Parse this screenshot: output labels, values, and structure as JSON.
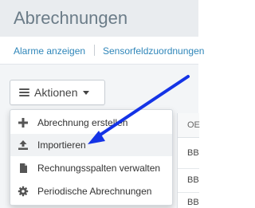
{
  "header": {
    "title": "Abrechnungen"
  },
  "subnav": {
    "alarms_link": "Alarme anzeigen",
    "sensor_link": "Sensorfeldzuordnungen"
  },
  "actions": {
    "label": "Aktionen",
    "icon": "hamburger-icon",
    "caret": "caret-down-icon"
  },
  "menu": {
    "items": [
      {
        "label": "Abrechnung erstellen",
        "icon": "plus-icon"
      },
      {
        "label": "Importieren",
        "icon": "upload-icon"
      },
      {
        "label": "Rechnungsspalten verwalten",
        "icon": "document-icon"
      },
      {
        "label": "Periodische Abrechnungen",
        "icon": "gear-icon"
      }
    ]
  },
  "table": {
    "column_header": "OE",
    "cells": [
      "BB",
      "BB",
      "BB"
    ]
  },
  "annotation": {
    "arrow_color": "#1433e6"
  }
}
